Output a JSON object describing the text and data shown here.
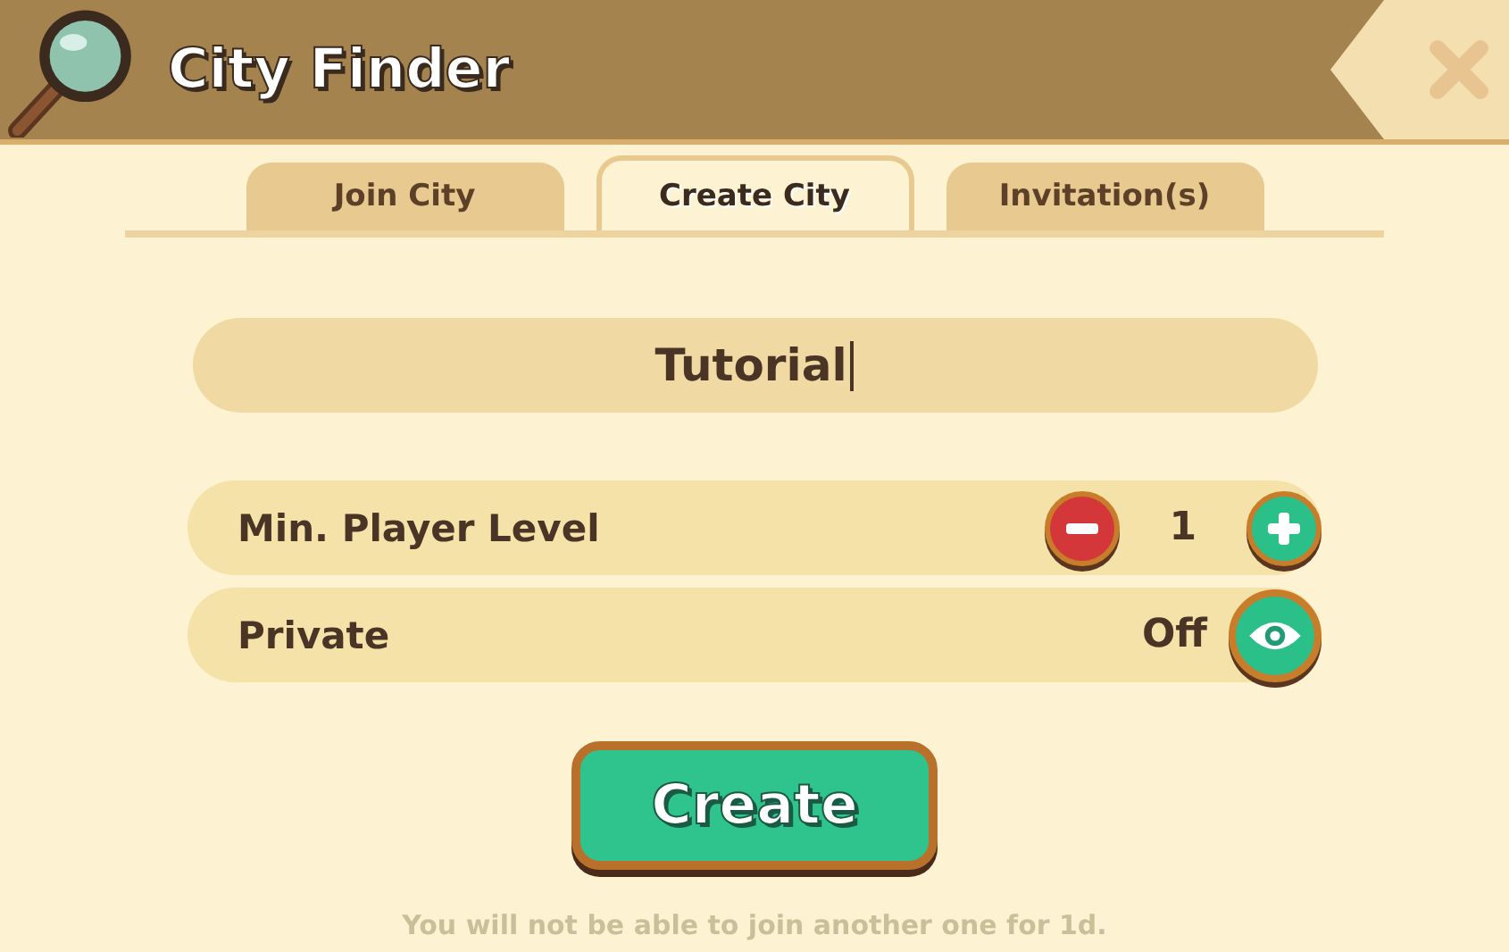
{
  "window": {
    "title": "City Finder"
  },
  "tabs": [
    {
      "label": "Join City",
      "selected": false
    },
    {
      "label": "Create City",
      "selected": true
    },
    {
      "label": "Invitation(s)",
      "selected": false
    }
  ],
  "name_field": {
    "value": "Tutorial"
  },
  "settings": [
    {
      "kind": "stepper",
      "label": "Min. Player Level",
      "value": "1"
    },
    {
      "kind": "toggle",
      "label": "Private",
      "value": "Off"
    }
  ],
  "create_button": "Create",
  "note": "You will not be able to join another one for 1d."
}
